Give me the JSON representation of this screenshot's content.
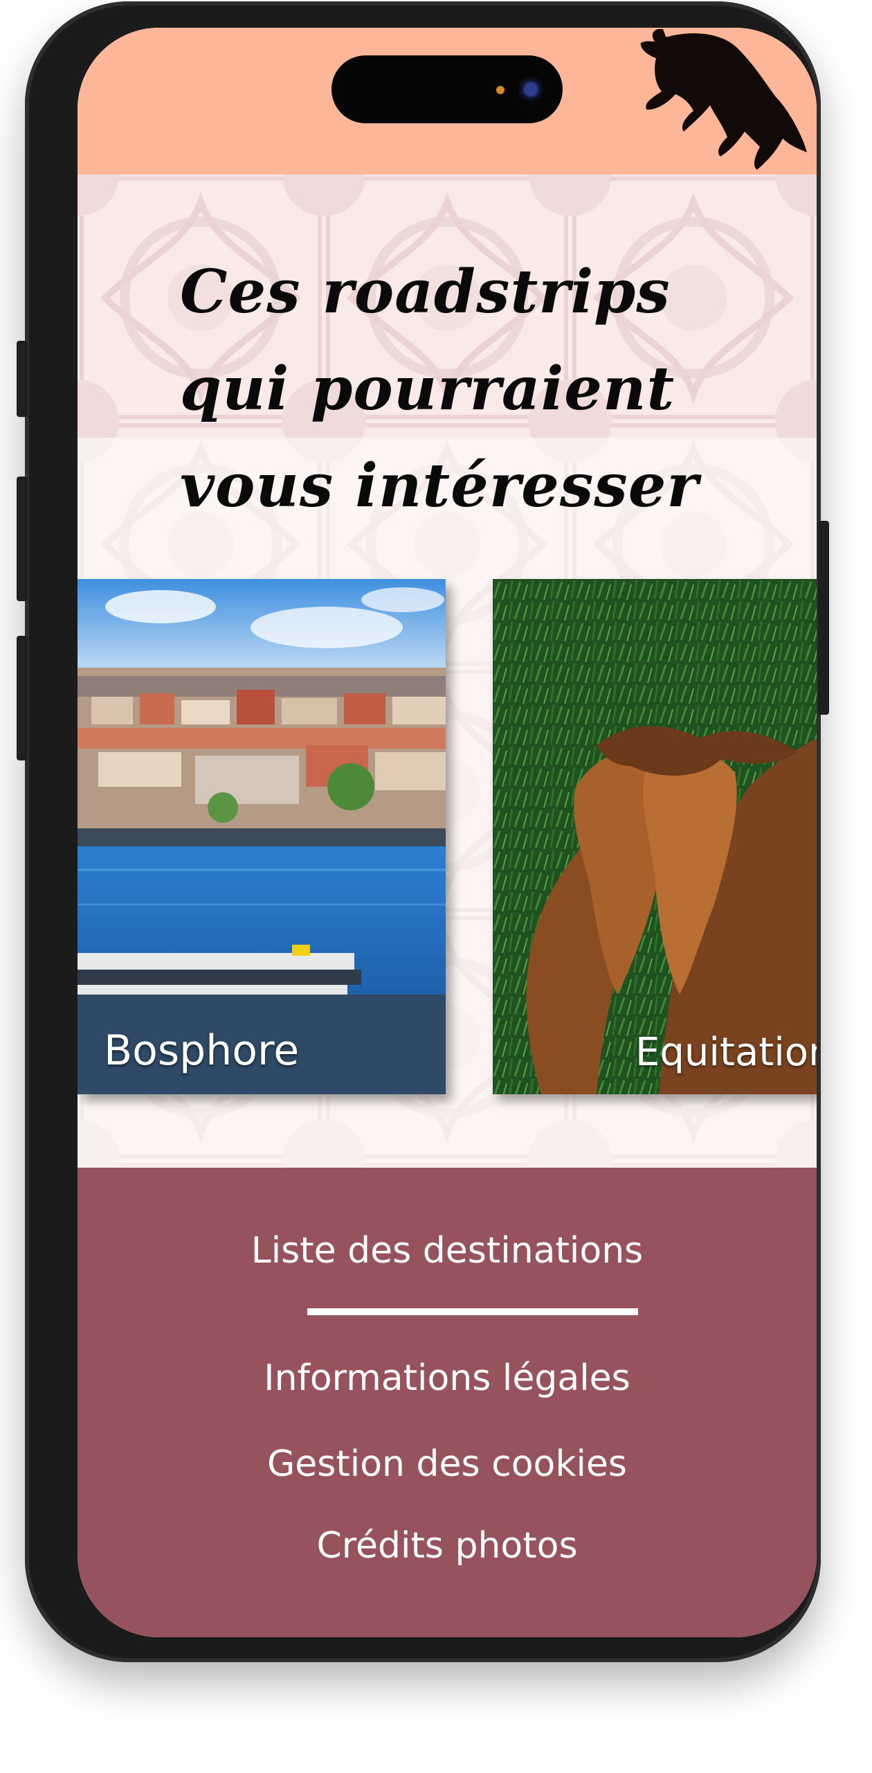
{
  "header": {
    "background": "#fdb698",
    "logo_icon": "rearing-horse-icon"
  },
  "hero": {
    "headline_lines": [
      "Ces roadstrips",
      "qui pourraient",
      "vous intéresser"
    ]
  },
  "cards": [
    {
      "label": "Bosphore",
      "image": "istanbul-bosphorus-photo"
    },
    {
      "label": "Equitation",
      "image": "two-horses-on-grass-photo"
    }
  ],
  "footer": {
    "background": "#96535b",
    "links": [
      "Liste des destinations",
      "Informations légales",
      "Gestion des cookies",
      "Crédits photos"
    ]
  }
}
